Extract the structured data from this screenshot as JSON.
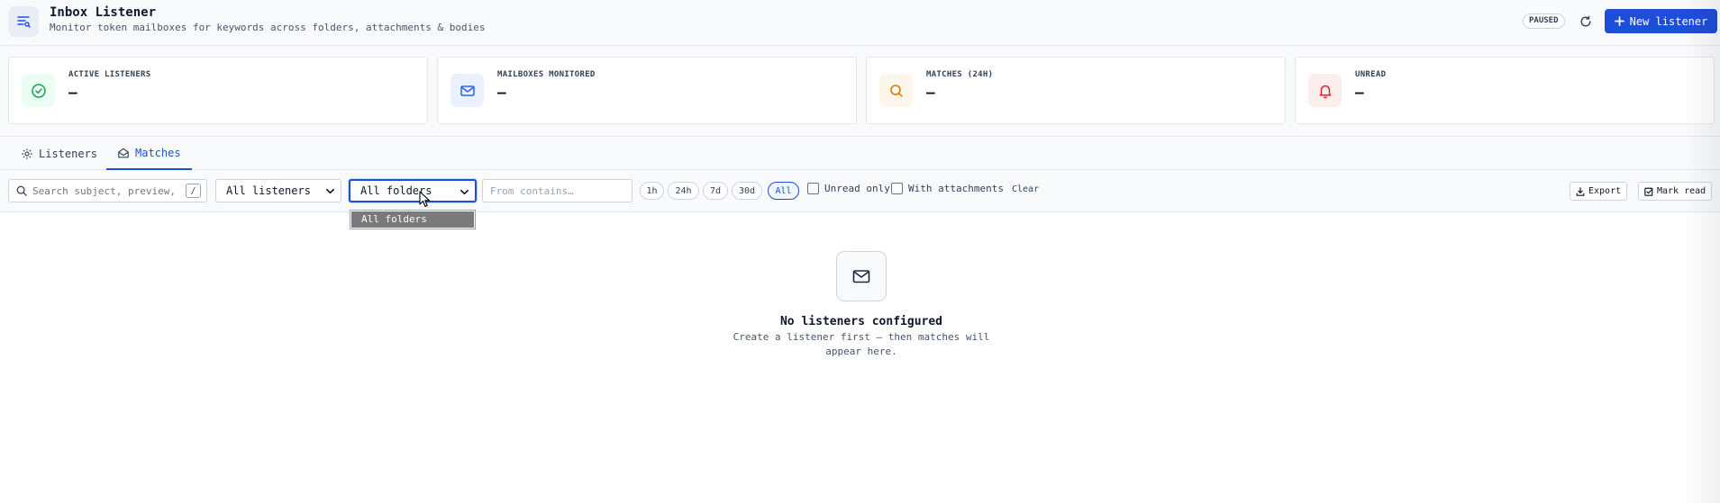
{
  "header": {
    "title": "Inbox Listener",
    "subtitle": "Monitor token mailboxes for keywords across folders, attachments & bodies",
    "status_badge": "PAUSED",
    "new_button_label": "New listener"
  },
  "stats": [
    {
      "label": "ACTIVE LISTENERS",
      "value": "—",
      "icon": "check-circle-icon",
      "color": "#16a34a",
      "bg": "#ecfdf3"
    },
    {
      "label": "MAILBOXES MONITORED",
      "value": "—",
      "icon": "mail-icon",
      "color": "#2563eb",
      "bg": "#eaf1fd"
    },
    {
      "label": "MATCHES (24H)",
      "value": "—",
      "icon": "search-icon",
      "color": "#d97706",
      "bg": "#fdf6ea"
    },
    {
      "label": "UNREAD",
      "value": "—",
      "icon": "bell-icon",
      "color": "#dc2626",
      "bg": "#fdeeee"
    }
  ],
  "tabs": [
    {
      "label": "Listeners",
      "icon": "gear-icon",
      "active": false
    },
    {
      "label": "Matches",
      "icon": "mail-open-icon",
      "active": true
    }
  ],
  "filters": {
    "search_placeholder": "Search subject, preview, body",
    "search_shortcut": "/",
    "listener_select": "All listeners",
    "folder_select": "All folders",
    "from_placeholder": "From contains…",
    "time_ranges": [
      "1h",
      "24h",
      "7d",
      "30d",
      "All"
    ],
    "active_range": "All",
    "unread_only_label": "Unread only",
    "with_attachments_label": "With attachments",
    "clear_label": "Clear",
    "export_label": "Export",
    "mark_read_label": "Mark read"
  },
  "folder_dropdown": {
    "options": [
      "All folders"
    ],
    "highlighted": "All folders"
  },
  "empty_state": {
    "title": "No listeners configured",
    "text": "Create a listener first — then matches will appear here."
  },
  "colors": {
    "accent": "#1d4ed8"
  }
}
